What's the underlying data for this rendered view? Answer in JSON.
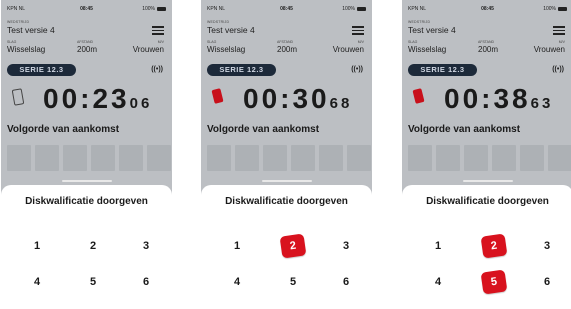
{
  "phones": [
    {
      "status": {
        "carrier": "KPN NL",
        "time": "08:45",
        "battery": "100%"
      },
      "competition_small": "WEDSTRIJD",
      "competition_name": "Test versie 4",
      "labels": {
        "stroke": "SLAG",
        "distance": "AFSTAND",
        "gender": "M/V"
      },
      "values": {
        "stroke": "Wisselslag",
        "distance": "200m",
        "gender": "Vrouwen"
      },
      "serie": "SERIE 12.3",
      "timer": "00:23",
      "timer_hundredths": "06",
      "card_state": "none",
      "arrival_title": "Volgorde van aankomst",
      "sheet_title": "Diskwalificatie doorgeven",
      "keys": [
        "1",
        "2",
        "3",
        "4",
        "5",
        "6"
      ],
      "selected_keys": []
    },
    {
      "status": {
        "carrier": "KPN NL",
        "time": "08:45",
        "battery": "100%"
      },
      "competition_small": "WEDSTRIJD",
      "competition_name": "Test versie 4",
      "labels": {
        "stroke": "SLAG",
        "distance": "AFSTAND",
        "gender": "M/V"
      },
      "values": {
        "stroke": "Wisselslag",
        "distance": "200m",
        "gender": "Vrouwen"
      },
      "serie": "SERIE 12.3",
      "timer": "00:30",
      "timer_hundredths": "68",
      "card_state": "red",
      "arrival_title": "Volgorde van aankomst",
      "sheet_title": "Diskwalificatie doorgeven",
      "keys": [
        "1",
        "2",
        "3",
        "4",
        "5",
        "6"
      ],
      "selected_keys": [
        "2"
      ]
    },
    {
      "status": {
        "carrier": "KPN NL",
        "time": "08:45",
        "battery": "100%"
      },
      "competition_small": "WEDSTRIJD",
      "competition_name": "Test versie 4",
      "labels": {
        "stroke": "SLAG",
        "distance": "AFSTAND",
        "gender": "M/V"
      },
      "values": {
        "stroke": "Wisselslag",
        "distance": "200m",
        "gender": "Vrouwen"
      },
      "serie": "SERIE 12.3",
      "timer": "00:38",
      "timer_hundredths": "63",
      "card_state": "red",
      "arrival_title": "Volgorde van aankomst",
      "sheet_title": "Diskwalificatie doorgeven",
      "keys": [
        "1",
        "2",
        "3",
        "4",
        "5",
        "6"
      ],
      "selected_keys": [
        "2",
        "5"
      ]
    }
  ],
  "colors": {
    "selected_key": "#d8121e",
    "serie_pill": "#1d2a3a",
    "overlay": "#bcbfc3"
  }
}
